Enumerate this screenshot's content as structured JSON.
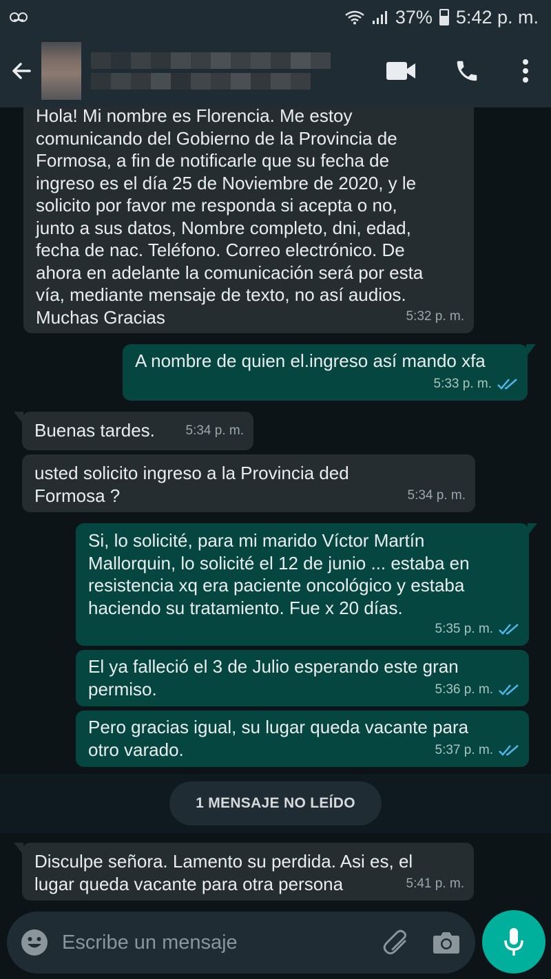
{
  "status_bar": {
    "battery": "37%",
    "time": "5:42 p. m.",
    "icons": [
      "voicemail-icon",
      "wifi-icon",
      "signal-icon",
      "battery-icon"
    ]
  },
  "header": {
    "icons": [
      "back-arrow-icon",
      "video-call-icon",
      "phone-icon",
      "more-vert-icon"
    ]
  },
  "messages": [
    {
      "direction": "in",
      "text": "Hola! Mi nombre es Florencia. Me estoy\ncomunicando del Gobierno de la Provincia de\nFormosa, a fin de notificarle que su fecha de\ningreso es el día 25 de Noviembre de 2020, y le\nsolicito por favor me responda si acepta o no,\njunto a sus datos, Nombre completo, dni, edad,\nfecha de nac. Teléfono. Correo electrónico. De\nahora en adelante la comunicación será por esta\nvía, mediante mensaje de texto, no así audios.\nMuchas Gracias",
      "time": "5:32 p. m."
    },
    {
      "direction": "out",
      "text": "A nombre de quien  el.ingreso así mando xfa",
      "time": "5:33 p. m.",
      "status": "read"
    },
    {
      "direction": "in",
      "text": "Buenas tardes.",
      "time": "5:34 p. m."
    },
    {
      "direction": "in",
      "text": "usted solicito ingreso a la Provincia ded\nFormosa ?",
      "time": "5:34 p. m."
    },
    {
      "direction": "out",
      "text": "Si, lo solicité, para mi marido Víctor Martín\nMallorquin,  lo solicité el 12 de junio ... estaba en\nresistencia xq era paciente oncológico y estaba\nhaciendo su tratamiento. Fue x 20 días.",
      "time": "5:35 p. m.",
      "status": "read"
    },
    {
      "direction": "out",
      "text": "El ya falleció el 3 de Julio esperando este gran\npermiso.",
      "time": "5:36 p. m.",
      "status": "read"
    },
    {
      "direction": "out",
      "text": "Pero gracias igual, su lugar queda vacante para\notro varado.",
      "time": "5:37 p. m.",
      "status": "read"
    },
    {
      "direction": "in",
      "text": "Disculpe señora. Lamento su perdida. Asi es, el\nlugar queda vacante para otra persona",
      "time": "5:41 p. m."
    }
  ],
  "unread_banner": "1 MENSAJE NO LEÍDO",
  "input": {
    "placeholder": "Escribe un mensaje",
    "icons": [
      "emoji-icon",
      "attach-icon",
      "camera-icon",
      "mic-icon"
    ]
  },
  "colors": {
    "background": "#0d1418",
    "bar": "#1f2c34",
    "incoming_bubble": "#262d31",
    "outgoing_bubble": "#054740",
    "read_ticks": "#4fb6ec",
    "mic_button": "#00af9c"
  }
}
